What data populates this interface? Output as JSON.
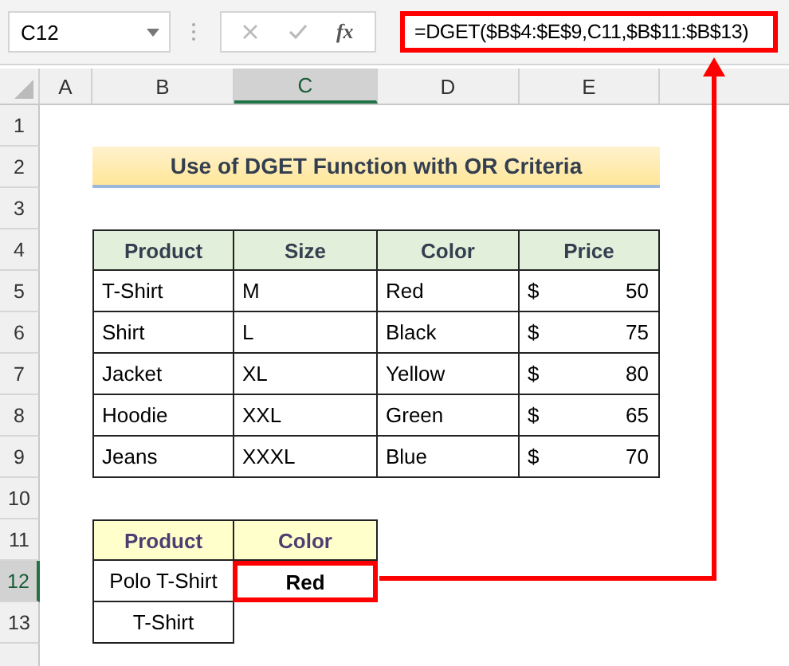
{
  "formula_bar": {
    "name_box": "C12",
    "function_label": "fx",
    "formula": "=DGET($B$4:$E$9,C11,$B$11:$B$13)",
    "highlighted": true
  },
  "columns": [
    {
      "label": "A",
      "selected": false
    },
    {
      "label": "B",
      "selected": false
    },
    {
      "label": "C",
      "selected": true
    },
    {
      "label": "D",
      "selected": false
    },
    {
      "label": "E",
      "selected": false
    }
  ],
  "rows": [
    {
      "label": "1",
      "selected": false
    },
    {
      "label": "2",
      "selected": false
    },
    {
      "label": "3",
      "selected": false
    },
    {
      "label": "4",
      "selected": false
    },
    {
      "label": "5",
      "selected": false
    },
    {
      "label": "6",
      "selected": false
    },
    {
      "label": "7",
      "selected": false
    },
    {
      "label": "8",
      "selected": false
    },
    {
      "label": "9",
      "selected": false
    },
    {
      "label": "10",
      "selected": false
    },
    {
      "label": "11",
      "selected": false
    },
    {
      "label": "12",
      "selected": true
    },
    {
      "label": "13",
      "selected": false
    }
  ],
  "title": "Use of DGET Function with OR Criteria",
  "table": {
    "columns": [
      "Product",
      "Size",
      "Color",
      "Price"
    ],
    "rows": [
      {
        "product": "T-Shirt",
        "size": "M",
        "color_name": "Red",
        "currency": "$",
        "price": "50"
      },
      {
        "product": "Shirt",
        "size": "L",
        "color_name": "Black",
        "currency": "$",
        "price": "75"
      },
      {
        "product": "Jacket",
        "size": "XL",
        "color_name": "Yellow",
        "currency": "$",
        "price": "80"
      },
      {
        "product": "Hoodie",
        "size": "XXL",
        "color_name": "Green",
        "currency": "$",
        "price": "65"
      },
      {
        "product": "Jeans",
        "size": "XXXL",
        "color_name": "Blue",
        "currency": "$",
        "price": "70"
      }
    ]
  },
  "criteria": {
    "columns": [
      "Product",
      "Color"
    ],
    "rows": [
      "Polo T-Shirt",
      "T-Shirt"
    ],
    "result": "Red",
    "result_highlighted": true
  }
}
